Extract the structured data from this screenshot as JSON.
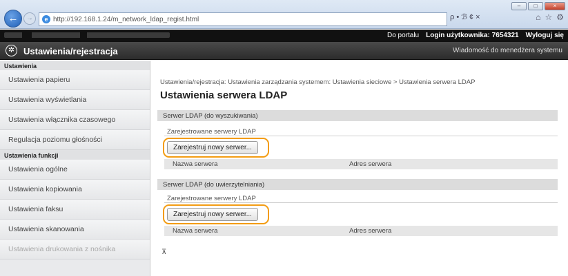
{
  "browser": {
    "url": "http://192.168.1.24/m_network_ldap_regist.html",
    "addr_tools": "ρ • ℬ ¢ ×"
  },
  "topbar": {
    "portal_link": "Do portalu",
    "login_label": "Login użytkownika:",
    "login_value": "7654321",
    "logout_link": "Wyloguj się"
  },
  "header": {
    "title": "Ustawienia/rejestracja",
    "admin_message": "Wiadomość do menedżera systemu"
  },
  "sidebar": {
    "section1": "Ustawienia",
    "items1": [
      "Ustawienia papieru",
      "Ustawienia wyświetlania",
      "Ustawienia włącznika czasowego",
      "Regulacja poziomu głośności"
    ],
    "section2": "Ustawienia funkcji",
    "items2": [
      "Ustawienia ogólne",
      "Ustawienia kopiowania",
      "Ustawienia faksu",
      "Ustawienia skanowania",
      "Ustawienia drukowania z nośnika"
    ]
  },
  "main": {
    "breadcrumb": "Ustawienia/rejestracja: Ustawienia zarządzania systemem: Ustawienia sieciowe > Ustawienia serwera LDAP",
    "page_title": "Ustawienia serwera LDAP",
    "search_section": {
      "heading": "Serwer LDAP (do wyszukiwania)",
      "sub_label": "Zarejestrowane serwery LDAP",
      "register_button": "Zarejestruj nowy serwer...",
      "col_name": "Nazwa serwera",
      "col_address": "Adres serwera"
    },
    "auth_section": {
      "heading": "Serwer LDAP (do uwierzytelniania)",
      "sub_label": "Zarejestrowane serwery LDAP",
      "register_button": "Zarejestruj nowy serwer...",
      "col_name": "Nazwa serwera",
      "col_address": "Adres serwera"
    },
    "scroll_top": "⊼"
  },
  "colors": {
    "highlight": "#f39c12",
    "titlebar": "#333333"
  }
}
